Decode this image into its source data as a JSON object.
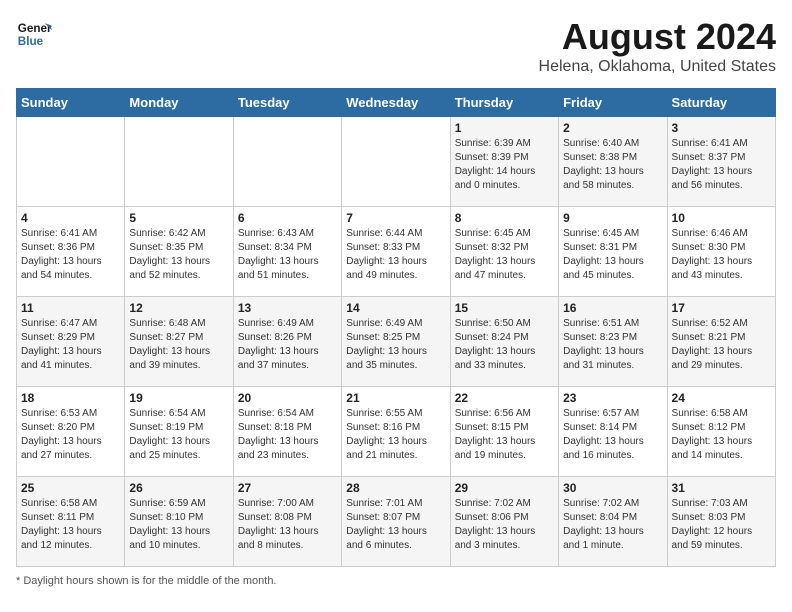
{
  "header": {
    "logo_line1": "General",
    "logo_line2": "Blue",
    "title": "August 2024",
    "subtitle": "Helena, Oklahoma, United States"
  },
  "weekdays": [
    "Sunday",
    "Monday",
    "Tuesday",
    "Wednesday",
    "Thursday",
    "Friday",
    "Saturday"
  ],
  "footer": {
    "note": "Daylight hours"
  },
  "weeks": [
    [
      {
        "day": "",
        "sunrise": "",
        "sunset": "",
        "daylight": ""
      },
      {
        "day": "",
        "sunrise": "",
        "sunset": "",
        "daylight": ""
      },
      {
        "day": "",
        "sunrise": "",
        "sunset": "",
        "daylight": ""
      },
      {
        "day": "",
        "sunrise": "",
        "sunset": "",
        "daylight": ""
      },
      {
        "day": "1",
        "sunrise": "Sunrise: 6:39 AM",
        "sunset": "Sunset: 8:39 PM",
        "daylight": "Daylight: 14 hours and 0 minutes."
      },
      {
        "day": "2",
        "sunrise": "Sunrise: 6:40 AM",
        "sunset": "Sunset: 8:38 PM",
        "daylight": "Daylight: 13 hours and 58 minutes."
      },
      {
        "day": "3",
        "sunrise": "Sunrise: 6:41 AM",
        "sunset": "Sunset: 8:37 PM",
        "daylight": "Daylight: 13 hours and 56 minutes."
      }
    ],
    [
      {
        "day": "4",
        "sunrise": "Sunrise: 6:41 AM",
        "sunset": "Sunset: 8:36 PM",
        "daylight": "Daylight: 13 hours and 54 minutes."
      },
      {
        "day": "5",
        "sunrise": "Sunrise: 6:42 AM",
        "sunset": "Sunset: 8:35 PM",
        "daylight": "Daylight: 13 hours and 52 minutes."
      },
      {
        "day": "6",
        "sunrise": "Sunrise: 6:43 AM",
        "sunset": "Sunset: 8:34 PM",
        "daylight": "Daylight: 13 hours and 51 minutes."
      },
      {
        "day": "7",
        "sunrise": "Sunrise: 6:44 AM",
        "sunset": "Sunset: 8:33 PM",
        "daylight": "Daylight: 13 hours and 49 minutes."
      },
      {
        "day": "8",
        "sunrise": "Sunrise: 6:45 AM",
        "sunset": "Sunset: 8:32 PM",
        "daylight": "Daylight: 13 hours and 47 minutes."
      },
      {
        "day": "9",
        "sunrise": "Sunrise: 6:45 AM",
        "sunset": "Sunset: 8:31 PM",
        "daylight": "Daylight: 13 hours and 45 minutes."
      },
      {
        "day": "10",
        "sunrise": "Sunrise: 6:46 AM",
        "sunset": "Sunset: 8:30 PM",
        "daylight": "Daylight: 13 hours and 43 minutes."
      }
    ],
    [
      {
        "day": "11",
        "sunrise": "Sunrise: 6:47 AM",
        "sunset": "Sunset: 8:29 PM",
        "daylight": "Daylight: 13 hours and 41 minutes."
      },
      {
        "day": "12",
        "sunrise": "Sunrise: 6:48 AM",
        "sunset": "Sunset: 8:27 PM",
        "daylight": "Daylight: 13 hours and 39 minutes."
      },
      {
        "day": "13",
        "sunrise": "Sunrise: 6:49 AM",
        "sunset": "Sunset: 8:26 PM",
        "daylight": "Daylight: 13 hours and 37 minutes."
      },
      {
        "day": "14",
        "sunrise": "Sunrise: 6:49 AM",
        "sunset": "Sunset: 8:25 PM",
        "daylight": "Daylight: 13 hours and 35 minutes."
      },
      {
        "day": "15",
        "sunrise": "Sunrise: 6:50 AM",
        "sunset": "Sunset: 8:24 PM",
        "daylight": "Daylight: 13 hours and 33 minutes."
      },
      {
        "day": "16",
        "sunrise": "Sunrise: 6:51 AM",
        "sunset": "Sunset: 8:23 PM",
        "daylight": "Daylight: 13 hours and 31 minutes."
      },
      {
        "day": "17",
        "sunrise": "Sunrise: 6:52 AM",
        "sunset": "Sunset: 8:21 PM",
        "daylight": "Daylight: 13 hours and 29 minutes."
      }
    ],
    [
      {
        "day": "18",
        "sunrise": "Sunrise: 6:53 AM",
        "sunset": "Sunset: 8:20 PM",
        "daylight": "Daylight: 13 hours and 27 minutes."
      },
      {
        "day": "19",
        "sunrise": "Sunrise: 6:54 AM",
        "sunset": "Sunset: 8:19 PM",
        "daylight": "Daylight: 13 hours and 25 minutes."
      },
      {
        "day": "20",
        "sunrise": "Sunrise: 6:54 AM",
        "sunset": "Sunset: 8:18 PM",
        "daylight": "Daylight: 13 hours and 23 minutes."
      },
      {
        "day": "21",
        "sunrise": "Sunrise: 6:55 AM",
        "sunset": "Sunset: 8:16 PM",
        "daylight": "Daylight: 13 hours and 21 minutes."
      },
      {
        "day": "22",
        "sunrise": "Sunrise: 6:56 AM",
        "sunset": "Sunset: 8:15 PM",
        "daylight": "Daylight: 13 hours and 19 minutes."
      },
      {
        "day": "23",
        "sunrise": "Sunrise: 6:57 AM",
        "sunset": "Sunset: 8:14 PM",
        "daylight": "Daylight: 13 hours and 16 minutes."
      },
      {
        "day": "24",
        "sunrise": "Sunrise: 6:58 AM",
        "sunset": "Sunset: 8:12 PM",
        "daylight": "Daylight: 13 hours and 14 minutes."
      }
    ],
    [
      {
        "day": "25",
        "sunrise": "Sunrise: 6:58 AM",
        "sunset": "Sunset: 8:11 PM",
        "daylight": "Daylight: 13 hours and 12 minutes."
      },
      {
        "day": "26",
        "sunrise": "Sunrise: 6:59 AM",
        "sunset": "Sunset: 8:10 PM",
        "daylight": "Daylight: 13 hours and 10 minutes."
      },
      {
        "day": "27",
        "sunrise": "Sunrise: 7:00 AM",
        "sunset": "Sunset: 8:08 PM",
        "daylight": "Daylight: 13 hours and 8 minutes."
      },
      {
        "day": "28",
        "sunrise": "Sunrise: 7:01 AM",
        "sunset": "Sunset: 8:07 PM",
        "daylight": "Daylight: 13 hours and 6 minutes."
      },
      {
        "day": "29",
        "sunrise": "Sunrise: 7:02 AM",
        "sunset": "Sunset: 8:06 PM",
        "daylight": "Daylight: 13 hours and 3 minutes."
      },
      {
        "day": "30",
        "sunrise": "Sunrise: 7:02 AM",
        "sunset": "Sunset: 8:04 PM",
        "daylight": "Daylight: 13 hours and 1 minute."
      },
      {
        "day": "31",
        "sunrise": "Sunrise: 7:03 AM",
        "sunset": "Sunset: 8:03 PM",
        "daylight": "Daylight: 12 hours and 59 minutes."
      }
    ]
  ]
}
